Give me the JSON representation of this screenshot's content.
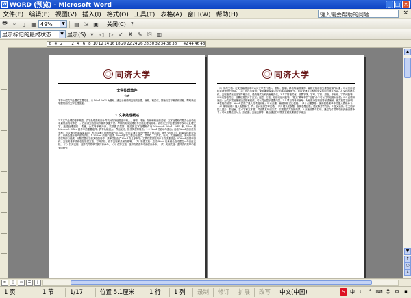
{
  "window": {
    "title": "WORD (预览) - Microsoft Word"
  },
  "menu": {
    "items": [
      "文件(F)",
      "编辑(E)",
      "视图(V)",
      "插入(I)",
      "格式(O)",
      "工具(T)",
      "表格(A)",
      "窗口(W)",
      "帮助(H)"
    ],
    "help_placeholder": "键入需要帮助的问题"
  },
  "toolbar1": {
    "zoom": "49%",
    "close_label": "关闭(C)"
  },
  "toolbar2": {
    "markup_select": "显示标记的最终状态",
    "show_label": "显示(S)"
  },
  "ruler": {
    "ticks": [
      "6",
      "4",
      "2",
      "",
      "2",
      "4",
      "6",
      "8",
      "10",
      "12",
      "14",
      "16",
      "18",
      "20",
      "22",
      "24",
      "26",
      "28",
      "30",
      "32",
      "34",
      "36",
      "38",
      "",
      "42",
      "44",
      "46",
      "48"
    ]
  },
  "page1": {
    "logo": "同济大学",
    "doc_title": "文字处理软件",
    "subtitle": "作者",
    "abstract": "本节介绍文字处理的主要方法，以 Word 2003 为基础，通过示例说明文档的创建、编辑、格式化、排版与打印等操作流程，帮助读者掌握常用的文字处理技能。",
    "section_title": "1 文字处理概述",
    "body": "1.1 文字处理的基本概念。文字处理是利用计算机对文字信息进行输入、编辑、排版、存储和输出的过程。文字处理软件是办公自动化中最常用的软件之一，它使得文档的制作变得快捷方便。早期的文字处理软件只能处理纯文本，而现代文字处理软件不仅可以处理文字，还能处理图形、表格、公式等多种对象，实现图文混排。常见的文字处理软件有 Microsoft Word、WPS 等。Word 是 Microsoft Office 套件中的重要组件，具有功能强大、界面友好、操作简便等特点。1.2 Word 的启动与退出。启动 Word 的方法有多种：可以通过开始菜单启动，也可以通过桌面快捷方式启动，还可以通过双击已有的文档启动。退出 Word 时，如果文档尚未保存，系统会提示用户保存文档。1.3 Word 的窗口组成。Word 窗口主要由标题栏、菜单栏、工具栏、标尺、文档编辑区、滚动条和状态栏等部分组成。标题栏显示当前文档的名称，菜单栏包含了 Word 的全部命令，工具栏提供常用命令的快捷按钮。2 Word 的基本操作。文档的基本操作包括新建文档、打开文档、保存文档和关闭文档等。（1）新建文档：启动 Word 后系统会自动建立一个空白文档。（2）打开文档：选择文件菜单中的打开命令。（3）保存文档：选择文件菜单中的保存命令。（4）关闭文档：选择文件菜单中的关闭命令。"
  },
  "page2": {
    "logo": "同济大学",
    "body": "（3）修改文档：在文档编辑区中可以对文字进行插入、删除、复制、移动等编辑操作。编辑文档前首先要选定操作对象，可以使用鼠标或键盘进行选定。（4）查找与替换：使用编辑菜单中的查找和替换命令，可以快速定位和修改文档中的指定内容。3 文档的格式化。文档格式化包括字符格式化、段落格式化和页面格式化。3.1 字符格式化：设置字体、字号、字形、颜色、下划线、字符间距等。3.2 段落格式化：设置段落的对齐方式、缩进、行距、段前段后间距等。“格式”菜单中的“段落”命令可以打开段落对话框。3.3 边框和底纹：为文字或段落添加边框和底纹，可以突出显示重要内容。3.4 项目符号和编号：为段落添加项目符号或编号，使文档层次分明。4 表格的制作。Word 提供了强大的表格功能，可以创建、编辑和格式化表格。（1）创建表格：使用表格菜单中的插入表格命令。（2）编辑表格：插入或删除行、列，合并或拆分单元格。（3）格式化表格：设置表格边框、底纹和对齐方式。5 图文混排。在文档中插入图片、剪贴画、艺术字和文本框，并设置其环绕方式，实现图文并茂的效果。6 页面设置与打印。通过文件菜单中的页面设置命令，可以设置纸张大小、页边距、页眉页脚等，最后通过打印预览查看效果并打印输出。"
  },
  "status": {
    "page": "1 页",
    "section": "1 节",
    "page_of": "1/17",
    "position": "位置 5.1厘米",
    "line": "1 行",
    "column": "1 列",
    "rec": "录制",
    "trk": "修订",
    "ext": "扩展",
    "ovr": "改写",
    "language": "中文(中国)"
  },
  "colors": {
    "title_bar": "#0d44c4",
    "logo": "#6a1a1a",
    "workspace": "#7f7f7f"
  }
}
